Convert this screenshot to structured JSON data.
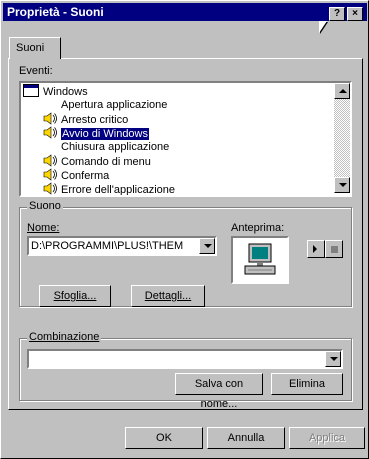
{
  "window": {
    "title": "Proprietà - Suoni",
    "help_btn": "?",
    "close_btn": "×"
  },
  "tabs": [
    {
      "label": "Suoni"
    }
  ],
  "events": {
    "label": "Eventi:",
    "items": [
      {
        "text": "Windows",
        "icon": "window-icon",
        "level": 0,
        "selected": false
      },
      {
        "text": "Apertura applicazione",
        "icon": "",
        "level": 1,
        "selected": false
      },
      {
        "text": "Arresto critico",
        "icon": "speaker-icon",
        "level": 1,
        "selected": false
      },
      {
        "text": "Avvio di Windows",
        "icon": "speaker-icon",
        "level": 1,
        "selected": true
      },
      {
        "text": "Chiusura applicazione",
        "icon": "",
        "level": 1,
        "selected": false
      },
      {
        "text": "Comando di menu",
        "icon": "speaker-icon",
        "level": 1,
        "selected": false
      },
      {
        "text": "Conferma",
        "icon": "speaker-icon",
        "level": 1,
        "selected": false
      },
      {
        "text": "Errore dell'applicazione",
        "icon": "speaker-icon",
        "level": 1,
        "selected": false
      }
    ]
  },
  "sound": {
    "group_label": "Suono",
    "name_label": "Nome:",
    "name_value": "D:\\PROGRAMMI\\PLUS!\\THEM",
    "preview_label": "Anteprima:",
    "browse_btn": "Sfoglia...",
    "details_btn": "Dettagli..."
  },
  "scheme": {
    "group_label": "Combinazione",
    "value": "",
    "save_as_btn": "Salva con nome...",
    "delete_btn": "Elimina"
  },
  "footer": {
    "ok": "OK",
    "cancel": "Annulla",
    "apply": "Applica"
  },
  "colors": {
    "title_bg": "#000080",
    "selection_bg": "#000080",
    "face": "#c0c0c0"
  }
}
